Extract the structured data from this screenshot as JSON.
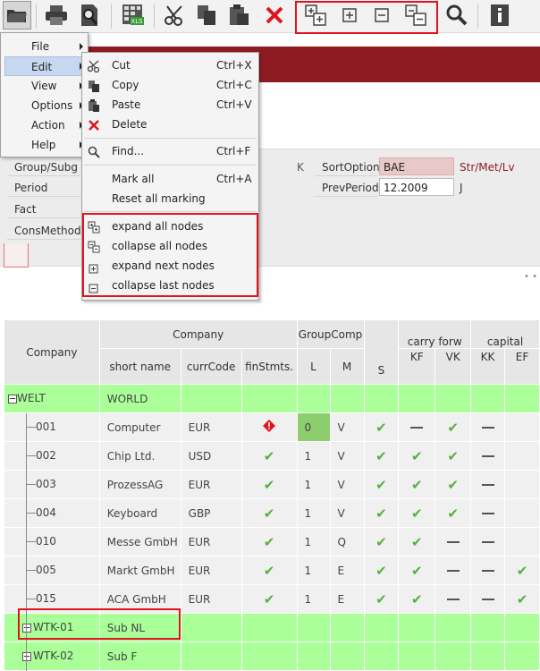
{
  "toolbar": {
    "buttons": [
      "open-icon",
      "print-icon",
      "print-preview-icon",
      "excel-export-icon",
      "cut-icon",
      "copy-icon",
      "paste-icon",
      "delete-icon",
      "expand-all-icon",
      "expand-next-icon",
      "collapse-last-icon",
      "collapse-all-icon",
      "search-icon",
      "info-icon"
    ]
  },
  "main_menu": {
    "items": [
      {
        "label": "File"
      },
      {
        "label": "Edit"
      },
      {
        "label": "View"
      },
      {
        "label": "Options"
      },
      {
        "label": "Action"
      },
      {
        "label": "Help"
      }
    ]
  },
  "edit_menu": {
    "cut": {
      "label": "Cut",
      "shortcut": "Ctrl+X"
    },
    "copy": {
      "label": "Copy",
      "shortcut": "Ctrl+C"
    },
    "paste": {
      "label": "Paste",
      "shortcut": "Ctrl+V"
    },
    "delete": {
      "label": "Delete"
    },
    "find": {
      "label": "Find...",
      "shortcut": "Ctrl+F"
    },
    "mark_all": {
      "label": "Mark all",
      "shortcut": "Ctrl+A"
    },
    "reset_marking": {
      "label": "Reset all marking"
    },
    "expand_all": {
      "label": "expand all nodes"
    },
    "collapse_all": {
      "label": "collapse all nodes"
    },
    "expand_next": {
      "label": "expand next nodes"
    },
    "collapse_last": {
      "label": "collapse last nodes"
    }
  },
  "form": {
    "group_subg": {
      "label": "Group/Subg",
      "suffix": "K"
    },
    "period": {
      "label": "Period"
    },
    "fact": {
      "label": "Fact"
    },
    "cons_method": {
      "label": "ConsMethod"
    },
    "sort_option": {
      "label": "SortOption",
      "value": "BAE",
      "suffix": "Str/Met/Lv"
    },
    "prev_period": {
      "label": "PrevPeriod",
      "value": "12.2009",
      "suffix": "J"
    }
  },
  "grid": {
    "headers": {
      "company": "Company",
      "company_group": "Company",
      "short_name": "short name",
      "curr_code": "currCode",
      "fin_stmts": "finStmts.",
      "group_comp": "GroupComp",
      "l": "L",
      "m": "M",
      "s": "S",
      "carry_forw": "carry forw",
      "kf": "KF",
      "vk": "VK",
      "capital": "capital",
      "kk": "KK",
      "ef": "EF"
    },
    "rows": [
      {
        "company": "WELT",
        "short_name": "WORLD",
        "curr": "",
        "fin": "",
        "l": "",
        "m": "",
        "s": "",
        "kf": "",
        "vk": "",
        "kk": "",
        "ef": "",
        "type": "group",
        "expander": "minus"
      },
      {
        "company": "001",
        "short_name": "Computer",
        "curr": "EUR",
        "fin": "warn",
        "l": "0",
        "m": "V",
        "s": "check",
        "kf": "dash",
        "vk": "check",
        "kk": "dash",
        "ef": "",
        "type": "leaf"
      },
      {
        "company": "002",
        "short_name": "Chip Ltd.",
        "curr": "USD",
        "fin": "check",
        "l": "1",
        "m": "V",
        "s": "check",
        "kf": "check",
        "vk": "check",
        "kk": "dash",
        "ef": "",
        "type": "leaf"
      },
      {
        "company": "003",
        "short_name": "ProzessAG",
        "curr": "EUR",
        "fin": "check",
        "l": "1",
        "m": "V",
        "s": "check",
        "kf": "check",
        "vk": "check",
        "kk": "dash",
        "ef": "",
        "type": "leaf"
      },
      {
        "company": "004",
        "short_name": "Keyboard",
        "curr": "GBP",
        "fin": "check",
        "l": "1",
        "m": "V",
        "s": "check",
        "kf": "check",
        "vk": "check",
        "kk": "dash",
        "ef": "",
        "type": "leaf"
      },
      {
        "company": "010",
        "short_name": "Messe GmbH",
        "curr": "EUR",
        "fin": "check",
        "l": "1",
        "m": "Q",
        "s": "check",
        "kf": "check",
        "vk": "dash",
        "kk": "dash",
        "ef": "",
        "type": "leaf"
      },
      {
        "company": "005",
        "short_name": "Markt GmbH",
        "curr": "EUR",
        "fin": "check",
        "l": "1",
        "m": "E",
        "s": "check",
        "kf": "check",
        "vk": "dash",
        "kk": "dash",
        "ef": "check",
        "type": "leaf"
      },
      {
        "company": "015",
        "short_name": "ACA GmbH",
        "curr": "EUR",
        "fin": "check",
        "l": "1",
        "m": "E",
        "s": "check",
        "kf": "check",
        "vk": "dash",
        "kk": "dash",
        "ef": "check",
        "type": "leaf"
      },
      {
        "company": "WTK-01",
        "short_name": "Sub NL",
        "curr": "",
        "fin": "",
        "l": "",
        "m": "",
        "s": "",
        "kf": "",
        "vk": "",
        "kk": "",
        "ef": "",
        "type": "group",
        "expander": "plus"
      },
      {
        "company": "WTK-02",
        "short_name": "Sub F",
        "curr": "",
        "fin": "",
        "l": "",
        "m": "",
        "s": "",
        "kf": "",
        "vk": "",
        "kk": "",
        "ef": "",
        "type": "group",
        "expander": "plus"
      }
    ]
  }
}
